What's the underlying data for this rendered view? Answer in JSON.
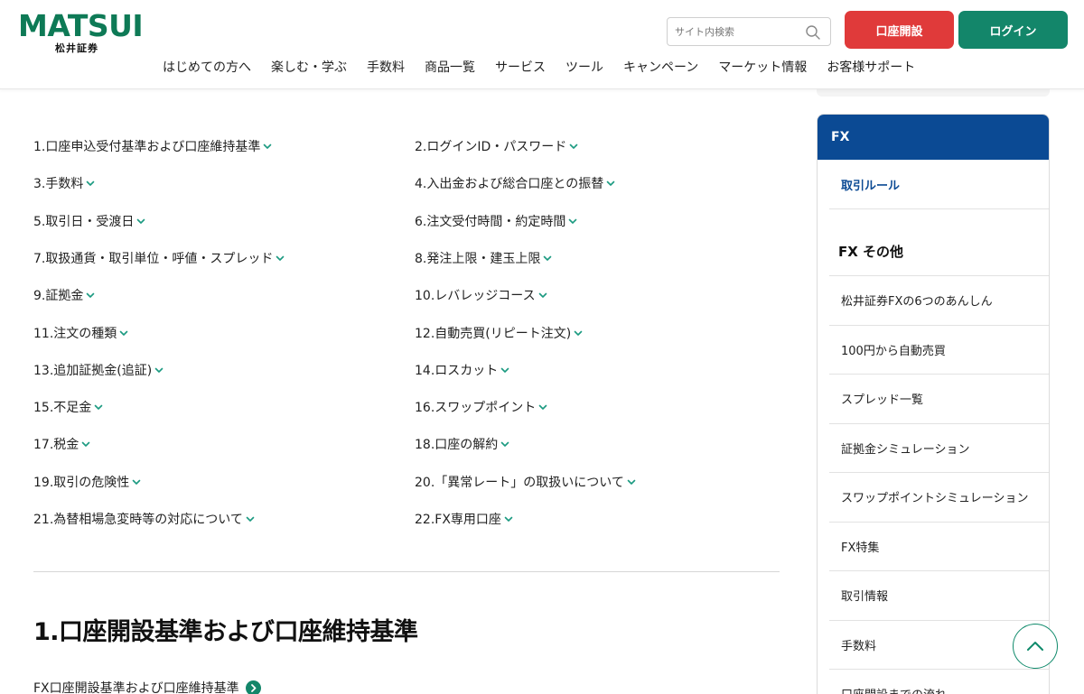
{
  "header": {
    "logo_text": "MATSUI",
    "logo_sub": "松井証券",
    "search_placeholder": "サイト内検索",
    "open_account_label": "口座開設",
    "login_label": "ログイン",
    "nav": [
      "はじめての方へ",
      "楽しむ・学ぶ",
      "手数料",
      "商品一覧",
      "サービス",
      "ツール",
      "キャンペーン",
      "マーケット情報",
      "お客様サポート"
    ]
  },
  "toc": {
    "left": [
      "1.口座申込受付基準および口座維持基準",
      "3.手数料",
      "5.取引日・受渡日",
      "7.取扱通貨・取引単位・呼値・スプレッド",
      "9.証拠金",
      "11.注文の種類",
      "13.追加証拠金(追証)",
      "15.不足金",
      "17.税金",
      "19.取引の危険性",
      "21.為替相場急変時等の対応について"
    ],
    "right": [
      "2.ログインID・パスワード",
      "4.入出金および総合口座との振替",
      "6.注文受付時間・約定時間",
      "8.発注上限・建玉上限",
      "10.レバレッジコース",
      "12.自動売買(リピート注文)",
      "14.ロスカット",
      "16.スワップポイント",
      "18.口座の解約",
      "20.「異常レート」の取扱いについて",
      "22.FX専用口座"
    ]
  },
  "section": {
    "heading": "1.口座開設基準および口座維持基準",
    "link": "FX口座開設基準および口座維持基準"
  },
  "sidebar": {
    "title": "FX",
    "active": "取引ルール",
    "section_title": "FX その他",
    "links": [
      "松井証券FXの6つのあんしん",
      "100円から自動売買",
      "スプレッド一覧",
      "証拠金シミュレーション",
      "スワップポイントシミュレーション",
      "FX特集",
      "取引情報",
      "手数料",
      "口座開設までの流れ"
    ]
  },
  "colors": {
    "brand_green": "#0e7a56",
    "open_red": "#e03a3a",
    "login_green": "#13866a",
    "sidebar_blue": "#0b4a94",
    "chevron_teal": "#1a9a80"
  }
}
